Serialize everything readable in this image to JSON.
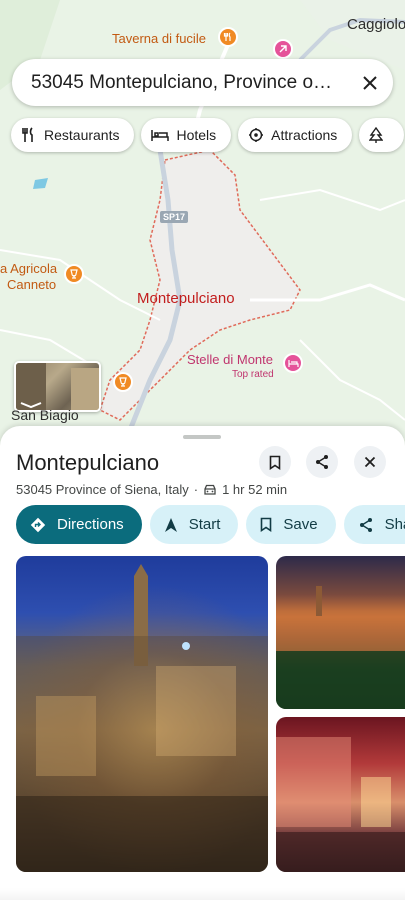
{
  "search": {
    "value": "53045 Montepulciano, Province o…"
  },
  "chips": [
    {
      "label": "Restaurants",
      "icon": "fork-knife-icon"
    },
    {
      "label": "Hotels",
      "icon": "bed-icon"
    },
    {
      "label": "Attractions",
      "icon": "attractions-icon"
    },
    {
      "label": "",
      "icon": "tree-icon"
    }
  ],
  "map": {
    "labels": {
      "taverna": "Taverna di fucile",
      "caggiolo": "Caggiolo",
      "agricola": "a Agricola\nCanneto",
      "agricola_line1": "a Agricola",
      "agricola_line2": "Canneto",
      "city": "Montepulciano",
      "stelle": "Stelle di Monte",
      "stelle_sub": "Top rated",
      "san_biagio": "San Biagio",
      "route": "SP17"
    },
    "colors": {
      "boundary": "#e06a5a",
      "land": "#e9f3e6"
    }
  },
  "place": {
    "title": "Montepulciano",
    "address": "53045 Province of Siena, Italy",
    "separator": "·",
    "drive_time": "1 hr 52 min"
  },
  "actions": {
    "directions": "Directions",
    "start": "Start",
    "save": "Save",
    "share": "Share"
  },
  "accent": "#0b6c7d"
}
